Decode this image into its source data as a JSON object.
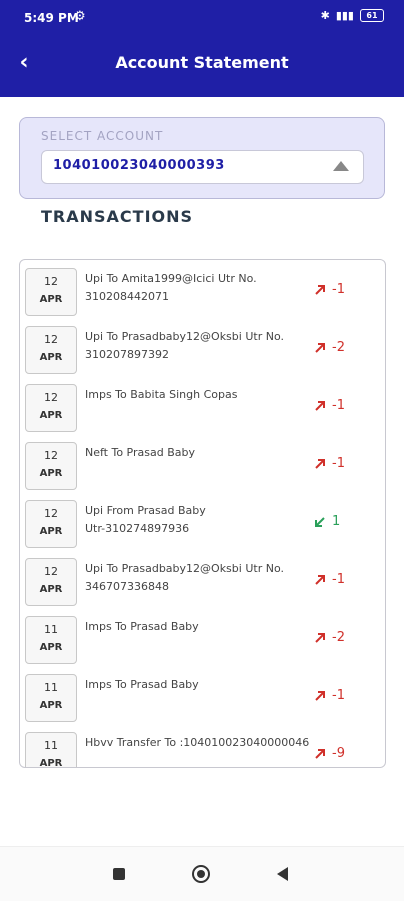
{
  "status_bar": {
    "time": "5:49 PM",
    "battery": "61"
  },
  "header": {
    "title": "Account Statement"
  },
  "select_account": {
    "label": "SELECT ACCOUNT",
    "value": "104010023040000393"
  },
  "transactions_title": "TRANSACTIONS",
  "transactions": [
    {
      "day": "12",
      "month": "APR",
      "line1": "Upi To Amita1999@Icici Utr No.",
      "line2": "310208442071",
      "amount": "-1",
      "type": "debit"
    },
    {
      "day": "12",
      "month": "APR",
      "line1": "Upi To Prasadbaby12@Oksbi Utr No.",
      "line2": "310207897392",
      "amount": "-2",
      "type": "debit"
    },
    {
      "day": "12",
      "month": "APR",
      "line1": "Imps To Babita Singh Copas",
      "line2": "",
      "amount": "-1",
      "type": "debit"
    },
    {
      "day": "12",
      "month": "APR",
      "line1": "Neft To Prasad Baby",
      "line2": "",
      "amount": "-1",
      "type": "debit"
    },
    {
      "day": "12",
      "month": "APR",
      "line1": "Upi From Prasad Baby",
      "line2": "Utr-310274897936",
      "amount": "1",
      "type": "credit"
    },
    {
      "day": "12",
      "month": "APR",
      "line1": "Upi To Prasadbaby12@Oksbi Utr No.",
      "line2": "346707336848",
      "amount": "-1",
      "type": "debit"
    },
    {
      "day": "11",
      "month": "APR",
      "line1": "Imps To Prasad Baby",
      "line2": "",
      "amount": "-2",
      "type": "debit"
    },
    {
      "day": "11",
      "month": "APR",
      "line1": "Imps To Prasad Baby",
      "line2": "",
      "amount": "-1",
      "type": "debit"
    },
    {
      "day": "11",
      "month": "APR",
      "line1": "Hbvv Transfer To :104010023040000046",
      "line2": "",
      "amount": "-9",
      "type": "debit"
    }
  ],
  "colors": {
    "brand": "#1f1fa6",
    "debit": "#d0302a",
    "credit": "#2aa05a"
  },
  "icons": {
    "back": "chevron-left-icon",
    "debit": "arrow-up-right-icon",
    "credit": "arrow-down-left-icon"
  }
}
